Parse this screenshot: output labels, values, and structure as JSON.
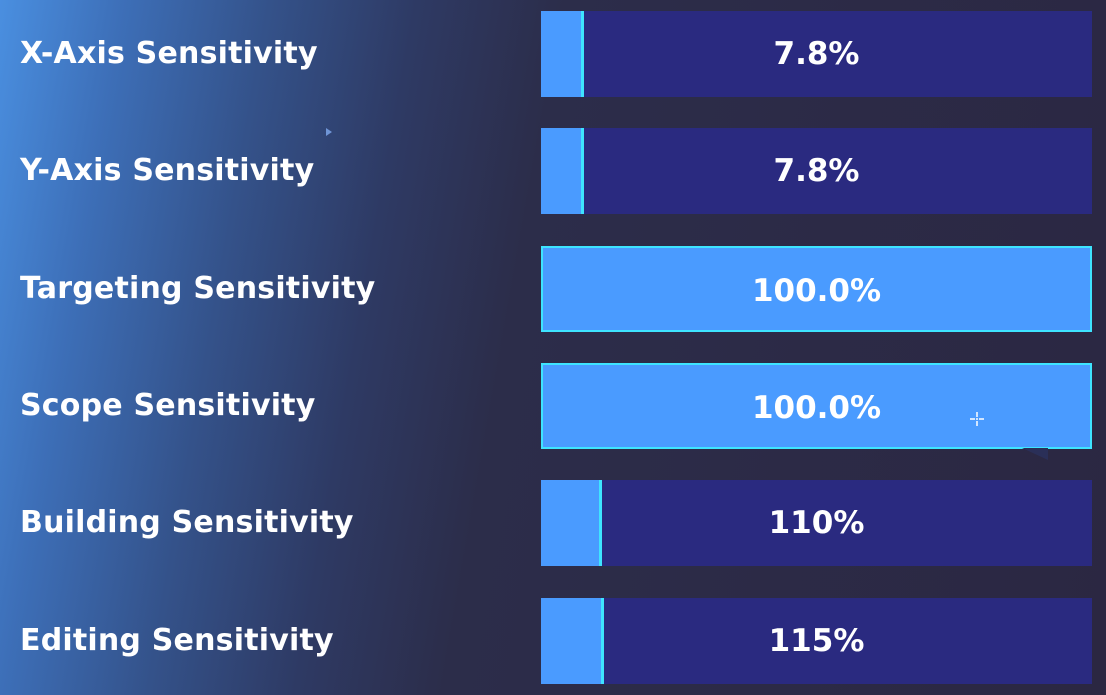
{
  "settings": [
    {
      "label": "X-Axis Sensitivity",
      "value_text": "7.8%",
      "fill_fraction": 0.078
    },
    {
      "label": "Y-Axis Sensitivity",
      "value_text": "7.8%",
      "fill_fraction": 0.078
    },
    {
      "label": "Targeting Sensitivity",
      "value_text": "100.0%",
      "fill_fraction": 1.0
    },
    {
      "label": "Scope Sensitivity",
      "value_text": "100.0%",
      "fill_fraction": 1.0
    },
    {
      "label": "Building Sensitivity",
      "value_text": "110%",
      "fill_fraction": 0.11
    },
    {
      "label": "Editing Sensitivity",
      "value_text": "115%",
      "fill_fraction": 0.115
    }
  ],
  "colors": {
    "slider_track": "#2a2a80",
    "slider_fill": "#4a9bff",
    "slider_edge": "#3ee4ff",
    "label_text": "#ffffff"
  },
  "icons": {
    "cursor": "crosshair-cursor-icon"
  }
}
